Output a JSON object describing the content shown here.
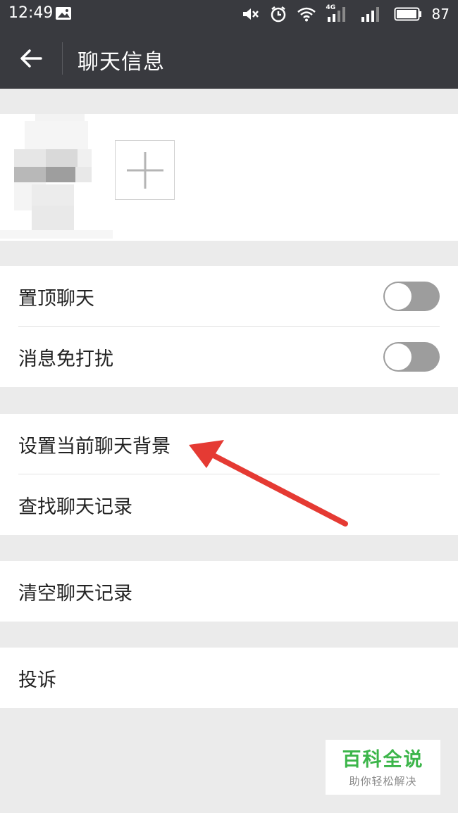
{
  "status_bar": {
    "time": "12:49",
    "network_label": "4G",
    "battery": "87"
  },
  "app_bar": {
    "title": "聊天信息",
    "back_icon": "arrow-left-icon"
  },
  "members": {
    "add_icon": "plus-icon"
  },
  "settings": {
    "group1": [
      {
        "label": "置顶聊天",
        "toggle_on": false
      },
      {
        "label": "消息免打扰",
        "toggle_on": false
      }
    ],
    "group2": [
      {
        "label": "设置当前聊天背景"
      },
      {
        "label": "查找聊天记录"
      }
    ],
    "group3": [
      {
        "label": "清空聊天记录"
      }
    ],
    "group4": [
      {
        "label": "投诉"
      }
    ]
  },
  "annotation": {
    "arrow_color": "#e53a33"
  },
  "watermark": {
    "title": "百科全说",
    "subtitle": "助你轻松解决",
    "color": "#3cb54a"
  },
  "colors": {
    "header": "#393a3f",
    "background": "#ebebeb",
    "toggle_off": "#9d9d9d"
  }
}
